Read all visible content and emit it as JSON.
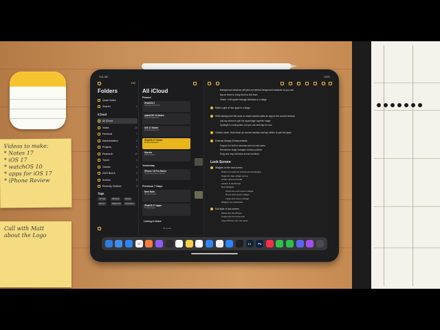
{
  "status": {
    "time": "9:41 AM",
    "battery": "100%"
  },
  "folders_pane": {
    "edit_label": "Edit",
    "title": "Folders",
    "rows": [
      {
        "label": "Quick Notes",
        "count": ""
      },
      {
        "label": "Shared",
        "count": "1"
      }
    ],
    "section_icloud": "iCloud",
    "icloud_rows": [
      {
        "label": "All iCloud",
        "count": "",
        "selected": true
      },
      {
        "label": "Notes",
        "count": "15"
      },
      {
        "label": "Personal",
        "count": "7"
      },
      {
        "label": "Administration",
        "count": "4"
      },
      {
        "label": "Projects",
        "count": "9"
      },
      {
        "label": "Research",
        "count": "12"
      },
      {
        "label": "Travel",
        "count": "3"
      },
      {
        "label": "Games",
        "count": "6"
      },
      {
        "label": "2023 BACA",
        "count": "2"
      },
      {
        "label": "Archive",
        "count": "8"
      },
      {
        "label": "Recently Deleted",
        "count": "5"
      }
    ],
    "tags_label": "Tags",
    "tags": [
      "All Tags",
      "#iPadOS",
      "#Notes",
      "#iOS17",
      "#WatchOS",
      "#VisionPro"
    ]
  },
  "list_pane": {
    "title": "All iCloud",
    "pinned_label": "Pinned",
    "pinned": [
      {
        "title": "iPadOS17",
        "sub": "Saturday  Personal"
      },
      {
        "title": "watchOS 10 Notes",
        "sub": "9/15/23  Research"
      },
      {
        "title": "iOS 17 Notes",
        "sub": "9/15/23  Research"
      },
      {
        "title": "iPadOS 17 Notes",
        "sub": "9/15/23  Research",
        "highlight": true
      },
      {
        "title": "Stories",
        "sub": "9/8/23  Notes"
      }
    ],
    "yesterday_label": "Yesterday",
    "yesterday": [
      {
        "title": "iPhone 15 Pro Notes",
        "sub": "Yesterday  iPhone Review"
      }
    ],
    "prev_label": "Previous 7 Days",
    "prev": [
      {
        "title": "New Note",
        "sub": "Monday  Notes"
      },
      {
        "title": "iPadOS 17 apps",
        "sub": "Sunday  Apps"
      }
    ],
    "last_item": "Linking in Notes",
    "footer": "84 Notes"
  },
  "note_pane": {
    "lines_top": [
      "Background windows will pick out behind foreground windows so you can",
      "tap on them to bring them to the front.",
      "Globe + left cycles through windows in a stage"
    ],
    "bullets": [
      {
        "text": "Make a grid of four apps in a stage",
        "subs": []
      },
      {
        "text": "Shift clicking from the dock or recent section adds an app to the current window",
        "subs": [
          "and tap others to pair the apps/stage together stage.",
          "Spotlight is coming later, but you can shift-tap for now."
        ]
      },
      {
        "text": "Toolbar mode: Hold down an current window and tap others to pair the apps",
        "subs": []
      },
      {
        "text": "External Display Enhancements",
        "subs": [
          "Support for built-in cameras and ext-web cams.",
          "Remember stage manager window position.",
          "Drag and drop windows across monitors."
        ]
      }
    ],
    "heading_lock": "Lock Screen",
    "lock_items": [
      {
        "text": "Widgets on the lock screen",
        "subs": [
          "Different modes for portrait and landscape.",
          "Supports date widget up top.",
          "Under clock in portrait",
          "column in landscape",
          "New Widgets",
          "Shortcuts Lock screen widget",
          "Home lock screen widget",
          "Large lock screen widget",
          "Widgets are interactive"
        ]
      },
      {
        "text": "Edit style of lock screen",
        "subs": [
          "Works like the iPhone",
          "Customize font and color",
          "Layer Photos over the clock"
        ]
      }
    ]
  },
  "dock_apps": [
    {
      "name": "finder",
      "glyph": "",
      "color": "#2f7be0"
    },
    {
      "name": "safari",
      "glyph": "",
      "color": "#3d8ff0"
    },
    {
      "name": "mail",
      "glyph": "",
      "color": "#2a86f0"
    },
    {
      "name": "calendar",
      "glyph": "17",
      "color": "#f4f4f4"
    },
    {
      "name": "photos",
      "glyph": "",
      "color": "#ff7b3a"
    },
    {
      "name": "shortcuts",
      "glyph": "",
      "color": "#8f5cf5"
    },
    {
      "name": "clock",
      "glyph": "",
      "color": "#2b2b2b"
    },
    {
      "name": "freeform",
      "glyph": "",
      "color": "#ffffff"
    },
    {
      "name": "notes",
      "glyph": "",
      "color": "#f6d24a"
    },
    {
      "name": "pencil-app",
      "glyph": "",
      "color": "#ffffff"
    },
    {
      "name": "files",
      "glyph": "",
      "color": "#2f86f0"
    },
    {
      "name": "cloud",
      "glyph": "",
      "color": "#f2f2f2"
    },
    {
      "name": "keynote",
      "glyph": "",
      "color": "#2c84ff"
    },
    {
      "name": "final-cut",
      "glyph": "",
      "color": "#1f1f1f"
    },
    {
      "name": "lightroom",
      "glyph": "Lr",
      "color": "#0f2438"
    },
    {
      "name": "photoshop",
      "glyph": "Ps",
      "color": "#0c2140"
    },
    {
      "name": "music",
      "glyph": "",
      "color": "#fa2d48"
    },
    {
      "name": "messages",
      "glyph": "",
      "color": "#2ec24a"
    },
    {
      "name": "facetime",
      "glyph": "",
      "color": "#2bbf4c"
    },
    {
      "name": "discord",
      "glyph": "",
      "color": "#5865f2"
    },
    {
      "name": "app-store",
      "glyph": "",
      "color": "#a54bf0"
    },
    {
      "name": "app-library",
      "glyph": "",
      "color": "#4a4a52"
    }
  ],
  "sticky_1": [
    "Videos to make:",
    "* Notes 17",
    "* iOS 17",
    "* watchOS 10",
    "* apps for iOS 17",
    "* iPhone Review"
  ],
  "sticky_2": [
    "Call with Matt",
    "about the Logo"
  ]
}
